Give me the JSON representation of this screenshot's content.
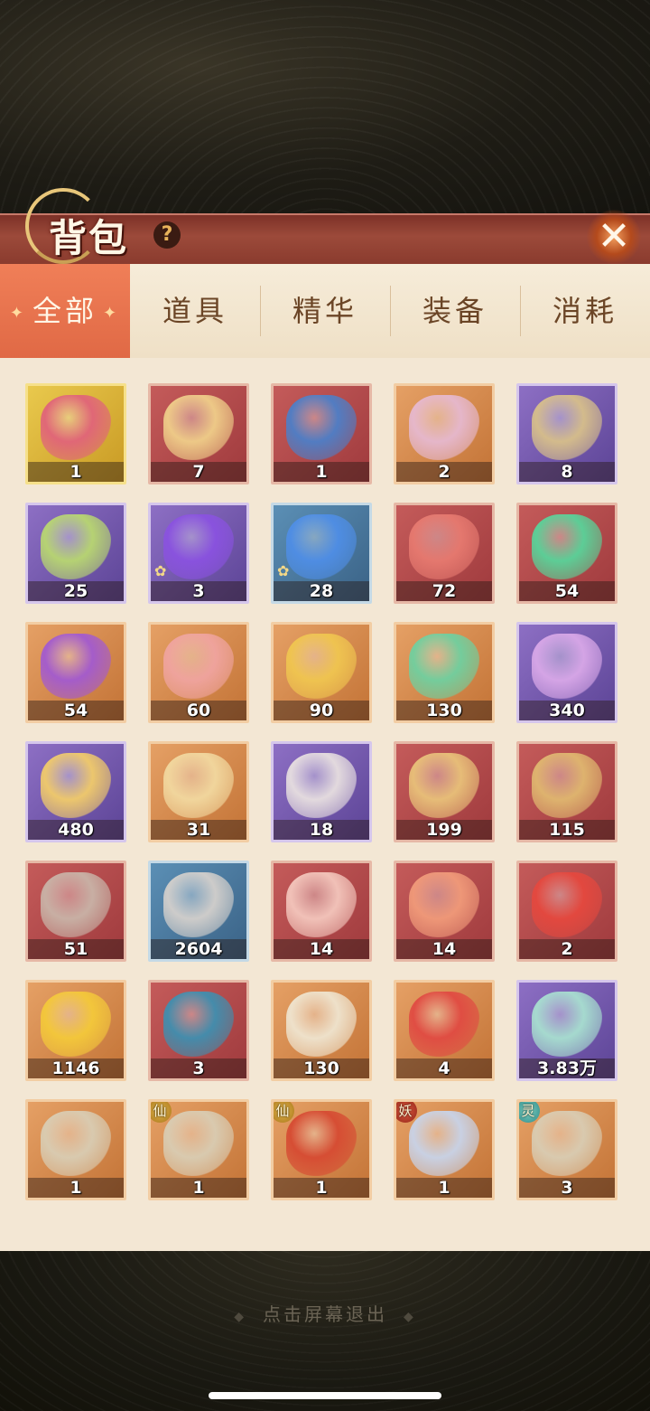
{
  "header": {
    "title": "背包",
    "help": "?",
    "close": "✕"
  },
  "tabs": [
    {
      "label": "全部",
      "active": true
    },
    {
      "label": "道具",
      "active": false
    },
    {
      "label": "精华",
      "active": false
    },
    {
      "label": "装备",
      "active": false
    },
    {
      "label": "消耗",
      "active": false
    }
  ],
  "items": [
    {
      "count": "1",
      "rarity": "gold",
      "icon": "butterfly-wings-icon",
      "art": "#e0637a"
    },
    {
      "count": "7",
      "rarity": "red",
      "icon": "golden-chest-icon",
      "art": "#f0cf8a"
    },
    {
      "count": "1",
      "rarity": "red",
      "icon": "blue-pouch-icon",
      "art": "#4d7fc8"
    },
    {
      "count": "2",
      "rarity": "orange",
      "icon": "flower-pouch-icon",
      "art": "#e6b9d0"
    },
    {
      "count": "8",
      "rarity": "purple",
      "icon": "card-box-icon",
      "art": "#d8c08a"
    },
    {
      "count": "25",
      "rarity": "purple",
      "icon": "rainbow-orb-chest-icon",
      "art": "#b9d870"
    },
    {
      "count": "3",
      "rarity": "purple",
      "icon": "purple-flame-icon",
      "art": "#8a52e0",
      "star": true
    },
    {
      "count": "28",
      "rarity": "blue",
      "icon": "blue-flame-icon",
      "art": "#4f8ee6",
      "star": true
    },
    {
      "count": "72",
      "rarity": "red",
      "icon": "red-potion-gourd-icon",
      "art": "#e77a70"
    },
    {
      "count": "54",
      "rarity": "red",
      "icon": "green-potion-gourd-icon",
      "art": "#58d49a"
    },
    {
      "count": "54",
      "rarity": "orange",
      "icon": "purple-potion-gourd-icon",
      "art": "#a25ad0"
    },
    {
      "count": "60",
      "rarity": "orange",
      "icon": "pink-potion-bottle-icon",
      "art": "#f0a4a0"
    },
    {
      "count": "90",
      "rarity": "orange",
      "icon": "yellow-potion-gourd-icon",
      "art": "#f0c650"
    },
    {
      "count": "130",
      "rarity": "orange",
      "icon": "green-potion-bottle-icon",
      "art": "#6fd0a0"
    },
    {
      "count": "340",
      "rarity": "purple",
      "icon": "lilac-potion-bottle-icon",
      "art": "#d9a8e8"
    },
    {
      "count": "480",
      "rarity": "purple",
      "icon": "amber-potion-bottle-icon",
      "art": "#f2cc6a"
    },
    {
      "count": "31",
      "rarity": "orange",
      "icon": "golden-scroll-icon",
      "art": "#f2d9a0"
    },
    {
      "count": "18",
      "rarity": "purple",
      "icon": "silver-scroll-icon",
      "art": "#e8e0e0"
    },
    {
      "count": "199",
      "rarity": "red",
      "icon": "golden-staff-icon",
      "art": "#e9c27a"
    },
    {
      "count": "115",
      "rarity": "red",
      "icon": "golden-spear-icon",
      "art": "#e0b870"
    },
    {
      "count": "51",
      "rarity": "red",
      "icon": "dagger-icon",
      "art": "#c9b4a8"
    },
    {
      "count": "2604",
      "rarity": "blue",
      "icon": "ore-stone-icon",
      "art": "#d4d0cc"
    },
    {
      "count": "14",
      "rarity": "red",
      "icon": "crystal-sand-tray-icon",
      "art": "#f4c7bd"
    },
    {
      "count": "14",
      "rarity": "red",
      "icon": "fire-essence-icon",
      "art": "#f19b7a"
    },
    {
      "count": "2",
      "rarity": "red",
      "icon": "phoenix-swirl-icon",
      "art": "#e5483e"
    },
    {
      "count": "1146",
      "rarity": "orange",
      "icon": "gold-nugget-icon",
      "art": "#f4c93a"
    },
    {
      "count": "3",
      "rarity": "red",
      "icon": "sword-banner-icon",
      "art": "#3f8fb0"
    },
    {
      "count": "130",
      "rarity": "orange",
      "icon": "spirit-vase-icon",
      "art": "#efe5d0"
    },
    {
      "count": "4",
      "rarity": "orange",
      "icon": "red-flower-bud-icon",
      "art": "#e04a42"
    },
    {
      "count": "3.83万",
      "rarity": "purple",
      "icon": "jade-dust-leaf-icon",
      "art": "#a8e0d0"
    },
    {
      "count": "1",
      "rarity": "orange",
      "icon": "battle-axe-icon",
      "art": "#d9cdb4"
    },
    {
      "count": "1",
      "rarity": "orange",
      "icon": "battle-axe-icon",
      "art": "#d9cdb4",
      "tag": "仙",
      "tagType": "t-xian"
    },
    {
      "count": "1",
      "rarity": "orange",
      "icon": "red-armor-icon",
      "art": "#d64a32",
      "tag": "仙",
      "tagType": "t-xian"
    },
    {
      "count": "1",
      "rarity": "orange",
      "icon": "curved-blade-icon",
      "art": "#c8d4ea",
      "tag": "妖",
      "tagType": "t-yao"
    },
    {
      "count": "3",
      "rarity": "orange",
      "icon": "battle-axe-icon",
      "art": "#d9cdb4",
      "tag": "灵",
      "tagType": "t-ling"
    }
  ],
  "footer": {
    "hint": "点击屏幕退出"
  }
}
